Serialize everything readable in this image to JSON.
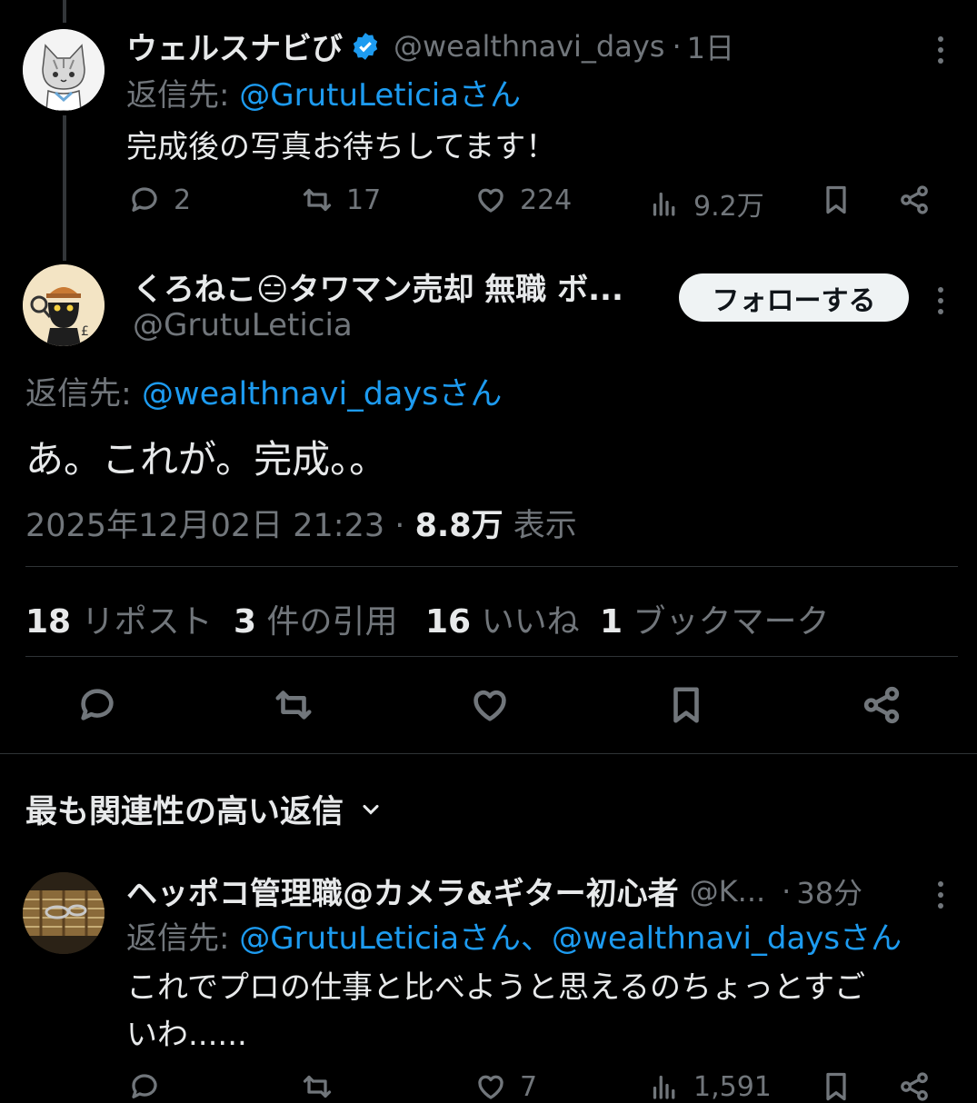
{
  "reply1": {
    "display_name": "ウェルスナビび",
    "handle": "@wealthnavi_days",
    "sep": "·",
    "time": "1日",
    "reply_prefix": "返信先:",
    "reply_to": "@GrutuLeticiaさん",
    "text": "完成後の写真お待ちしてます！",
    "counts": {
      "replies": "2",
      "reposts": "17",
      "likes": "224",
      "views": "9.2万"
    }
  },
  "main_tweet": {
    "display_name": "くろねこ😑タワマン売却 無職 ボ...",
    "handle": "@GrutuLeticia",
    "follow_label": "フォローする",
    "reply_prefix": "返信先:",
    "reply_to": "@wealthnavi_daysさん",
    "text": "あ。これが。完成。。",
    "timestamp": "2025年12月02日 21:23",
    "sep": "·",
    "views_count": "8.8万",
    "views_label": "表示",
    "stats": {
      "reposts_count": "18",
      "reposts_label": "リポスト",
      "quotes_count": "3",
      "quotes_label": "件の引用",
      "likes_count": "16",
      "likes_label": "いいね",
      "bookmarks_count": "1",
      "bookmarks_label": "ブックマーク"
    }
  },
  "sort": {
    "label": "最も関連性の高い返信"
  },
  "reply2": {
    "display_name": "ヘッポコ管理職@カメラ&ギター初心者",
    "handle": "@K...",
    "sep": "·",
    "time": "38分",
    "reply_prefix": "返信先:",
    "reply_to": "@GrutuLeticiaさん、@wealthnavi_daysさん",
    "text_line1": "これでプロの仕事と比べようと思えるのちょっとすご",
    "text_line2": "いわ......",
    "counts": {
      "likes": "7",
      "views": "1,591"
    }
  },
  "colors": {
    "accent": "#1d9bf0",
    "muted": "#71767b",
    "text": "#e7e9ea",
    "bg": "#000000"
  },
  "icons": [
    "verified-badge-icon",
    "reply-icon",
    "repost-icon",
    "like-icon",
    "views-icon",
    "bookmark-icon",
    "share-icon",
    "more-icon",
    "chevron-down-icon"
  ]
}
